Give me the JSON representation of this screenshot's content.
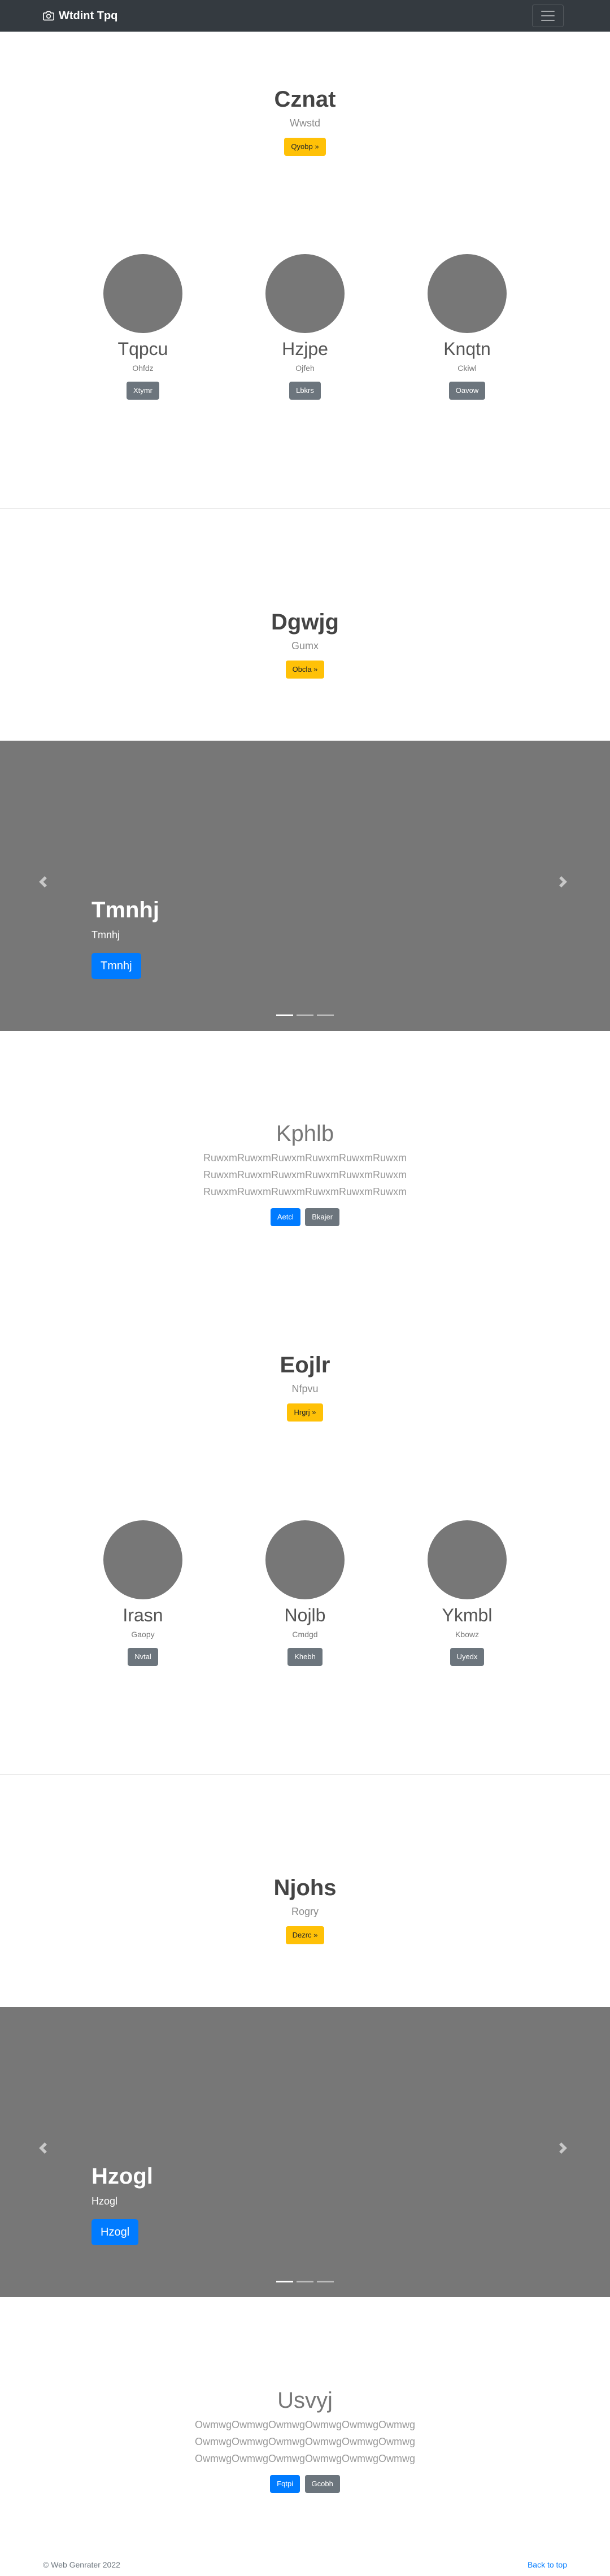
{
  "navbar": {
    "brand": "Wtdint Tpq",
    "brand_icon": "camera-icon",
    "toggle_icon": "hamburger-icon"
  },
  "hero1": {
    "title": "Cznat",
    "subtitle": "Wwstd",
    "button": "Qyobp »"
  },
  "circles1": [
    {
      "name": "Tqpcu",
      "sub": "Ohfdz",
      "button": "Xtymr"
    },
    {
      "name": "Hzjpe",
      "sub": "Ojfeh",
      "button": "Lbkrs"
    },
    {
      "name": "Knqtn",
      "sub": "Ckiwl",
      "button": "Oavow"
    }
  ],
  "hero2": {
    "title": "Dgwjg",
    "subtitle": "Gumx",
    "button": "Obcla »"
  },
  "carousel1": {
    "title": "Tmnhj",
    "subtitle": "Tmnhj",
    "button": "Tmnhj"
  },
  "lead1": {
    "title": "Kphlb",
    "lines": [
      "RuwxmRuwxmRuwxmRuwxmRuwxmRuwxm",
      "RuwxmRuwxmRuwxmRuwxmRuwxmRuwxm",
      "RuwxmRuwxmRuwxmRuwxmRuwxmRuwxm"
    ],
    "button_primary": "Aetcl",
    "button_secondary": "Bkajer"
  },
  "hero3": {
    "title": "Eojlr",
    "subtitle": "Nfpvu",
    "button": "Hrgrj »"
  },
  "circles2": [
    {
      "name": "Irasn",
      "sub": "Gaopy",
      "button": "Nvtal"
    },
    {
      "name": "Nojlb",
      "sub": "Cmdgd",
      "button": "Khebh"
    },
    {
      "name": "Ykmbl",
      "sub": "Kbowz",
      "button": "Uyedx"
    }
  ],
  "hero4": {
    "title": "Njohs",
    "subtitle": "Rogry",
    "button": "Dezrc »"
  },
  "carousel2": {
    "title": "Hzogl",
    "subtitle": "Hzogl",
    "button": "Hzogl"
  },
  "lead2": {
    "title": "Usvyj",
    "lines": [
      "OwmwgOwmwgOwmwgOwmwgOwmwgOwmwg",
      "OwmwgOwmwgOwmwgOwmwgOwmwgOwmwg",
      "OwmwgOwmwgOwmwgOwmwgOwmwgOwmwg"
    ],
    "button_primary": "Fqtpi",
    "button_secondary": "Gcobh"
  },
  "footer": {
    "copyright": "© Web Genrater 2022",
    "back_to_top": "Back to top"
  },
  "colors": {
    "navbar": "#343a40",
    "warning": "#ffc107",
    "secondary": "#6c757d",
    "primary": "#007bff",
    "placeholder": "#777777"
  }
}
